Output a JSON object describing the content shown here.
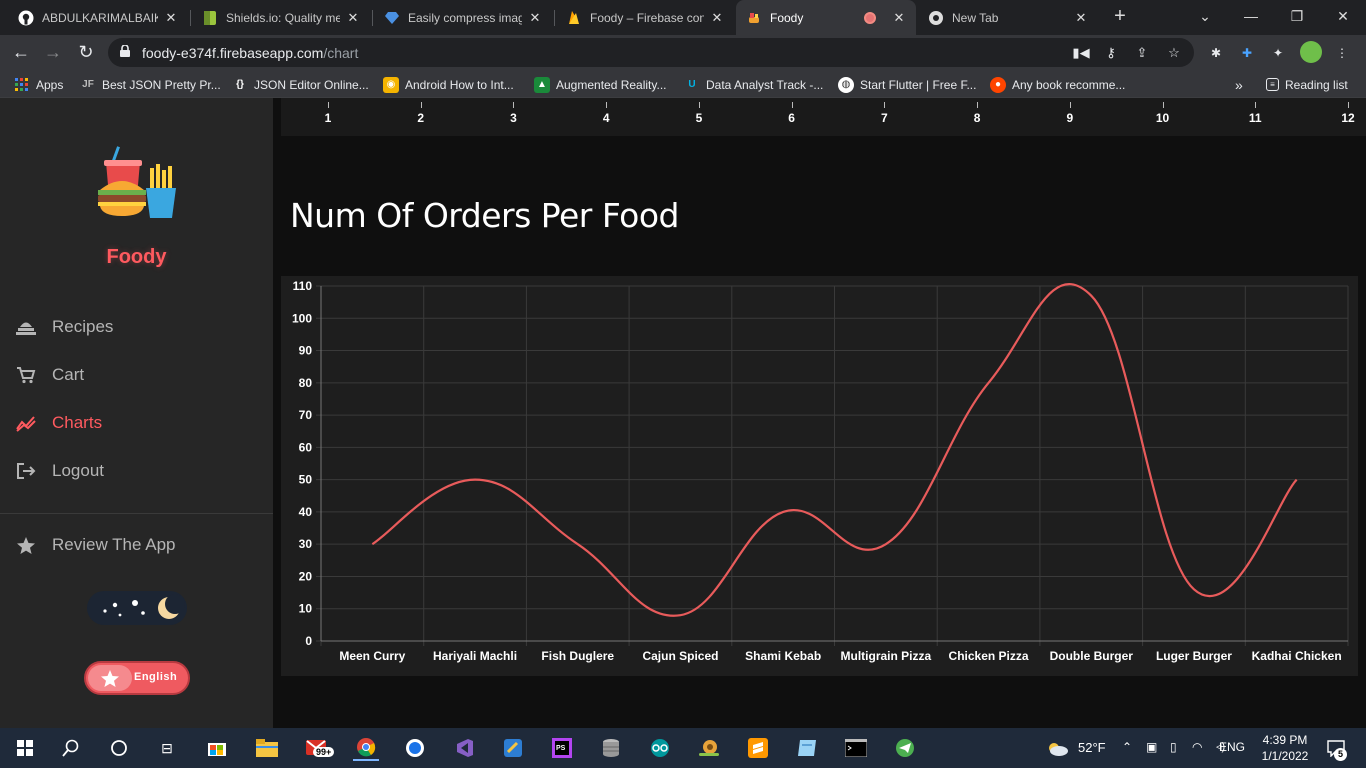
{
  "browser": {
    "tabs": [
      {
        "title": "ABDULKARIMALBAIK/",
        "icon": "github-icon"
      },
      {
        "title": "Shields.io: Quality met",
        "icon": "shields-icon"
      },
      {
        "title": "Easily compress image",
        "icon": "diamond-icon"
      },
      {
        "title": "Foody – Firebase cons",
        "icon": "firebase-icon"
      },
      {
        "title": "Foody",
        "icon": "foody-icon",
        "active": true
      },
      {
        "title": "New Tab",
        "icon": "chrome-icon"
      }
    ],
    "url_host": "foody-e374f.firebaseapp.com",
    "url_path": "/chart",
    "bookmarks": [
      {
        "label": "Apps",
        "icon": "apps-grid-icon"
      },
      {
        "label": "Best JSON Pretty Pr...",
        "icon": "jf-icon"
      },
      {
        "label": "JSON Editor Online...",
        "icon": "braces-icon"
      },
      {
        "label": "Android How to Int...",
        "icon": "android-icon"
      },
      {
        "label": "Augmented Reality...",
        "icon": "ar-icon"
      },
      {
        "label": "Data Analyst Track -...",
        "icon": "udacity-icon"
      },
      {
        "label": "Start Flutter | Free F...",
        "icon": "globe-icon"
      },
      {
        "label": "Any book recomme...",
        "icon": "reddit-icon"
      }
    ],
    "reading_list": "Reading list",
    "more_chevron": "»"
  },
  "sidebar": {
    "brand": "Foody",
    "nav": [
      {
        "label": "Recipes",
        "icon": "recipes-icon"
      },
      {
        "label": "Cart",
        "icon": "cart-icon"
      },
      {
        "label": "Charts",
        "icon": "chart-icon",
        "active": true
      },
      {
        "label": "Logout",
        "icon": "logout-icon"
      }
    ],
    "review": "Review The App",
    "language": "English"
  },
  "previous_chart_axis": {
    "ticks": [
      "1",
      "2",
      "3",
      "4",
      "5",
      "6",
      "7",
      "8",
      "9",
      "10",
      "11",
      "12"
    ]
  },
  "section_title": "Num Of Orders Per Food",
  "colors": {
    "accent": "#ff5a5f",
    "line": "#e85b5b",
    "sidebar_bg": "#262626",
    "chart_bg": "#1e1e1e"
  },
  "chart_data": {
    "type": "line",
    "categories": [
      "Meen Curry",
      "Hariyali Machli",
      "Fish Duglere",
      "Cajun Spiced",
      "Shami Kebab",
      "Multigrain Pizza",
      "Chicken Pizza",
      "Double Burger",
      "Luger Burger",
      "Kadhai Chicken"
    ],
    "values": [
      30,
      50,
      30,
      8,
      40,
      30,
      80,
      107,
      16,
      50
    ],
    "ylim": [
      0,
      110
    ],
    "yticks": [
      0,
      10,
      20,
      30,
      40,
      50,
      60,
      70,
      80,
      90,
      100,
      110
    ],
    "grid": true,
    "smooth": true
  },
  "taskbar": {
    "weather": "52°F",
    "lang": "ENG",
    "time": "4:39 PM",
    "date": "1/1/2022",
    "badge_count": "99+",
    "notif_count": "5"
  }
}
